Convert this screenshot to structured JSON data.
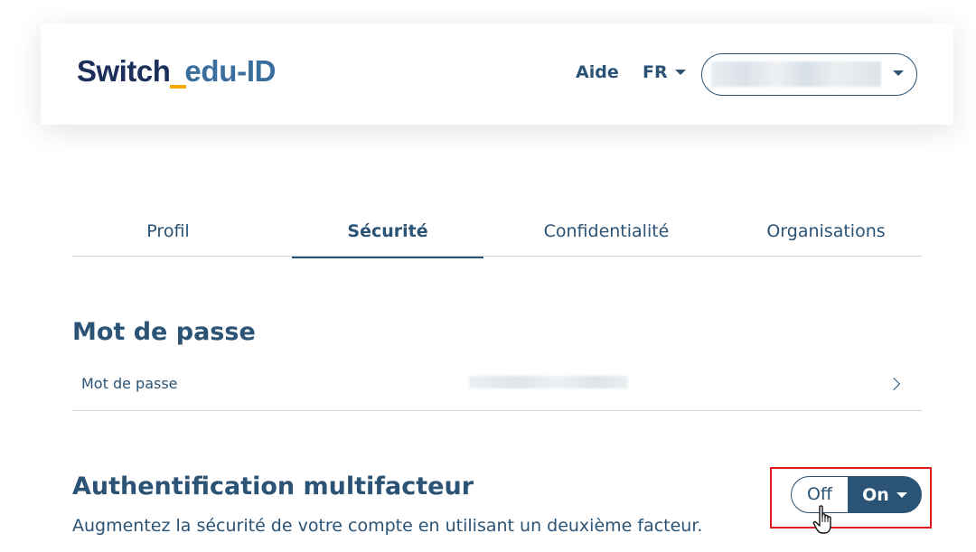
{
  "header": {
    "logo": {
      "part1": "Switch",
      "part2": "edu-ID"
    },
    "help_label": "Aide",
    "language": "FR"
  },
  "tabs": [
    {
      "label": "Profil",
      "active": false
    },
    {
      "label": "Sécurité",
      "active": true
    },
    {
      "label": "Confidentialité",
      "active": false
    },
    {
      "label": "Organisations",
      "active": false
    }
  ],
  "password_section": {
    "title": "Mot de passe",
    "row_label": "Mot de passe"
  },
  "mfa_section": {
    "title": "Authentification multifacteur",
    "description": "Augmentez la sécurité de votre compte en utilisant un deuxième facteur.",
    "toggle": {
      "off_label": "Off",
      "on_label": "On",
      "selected": "On"
    }
  },
  "colors": {
    "primary": "#2b5375",
    "logo_dark": "#1c2e5a",
    "logo_accent": "#f5a800",
    "highlight": "#e0191e"
  },
  "icons": [
    "chevron-down-icon",
    "chevron-right-icon",
    "hand-pointer-icon"
  ]
}
